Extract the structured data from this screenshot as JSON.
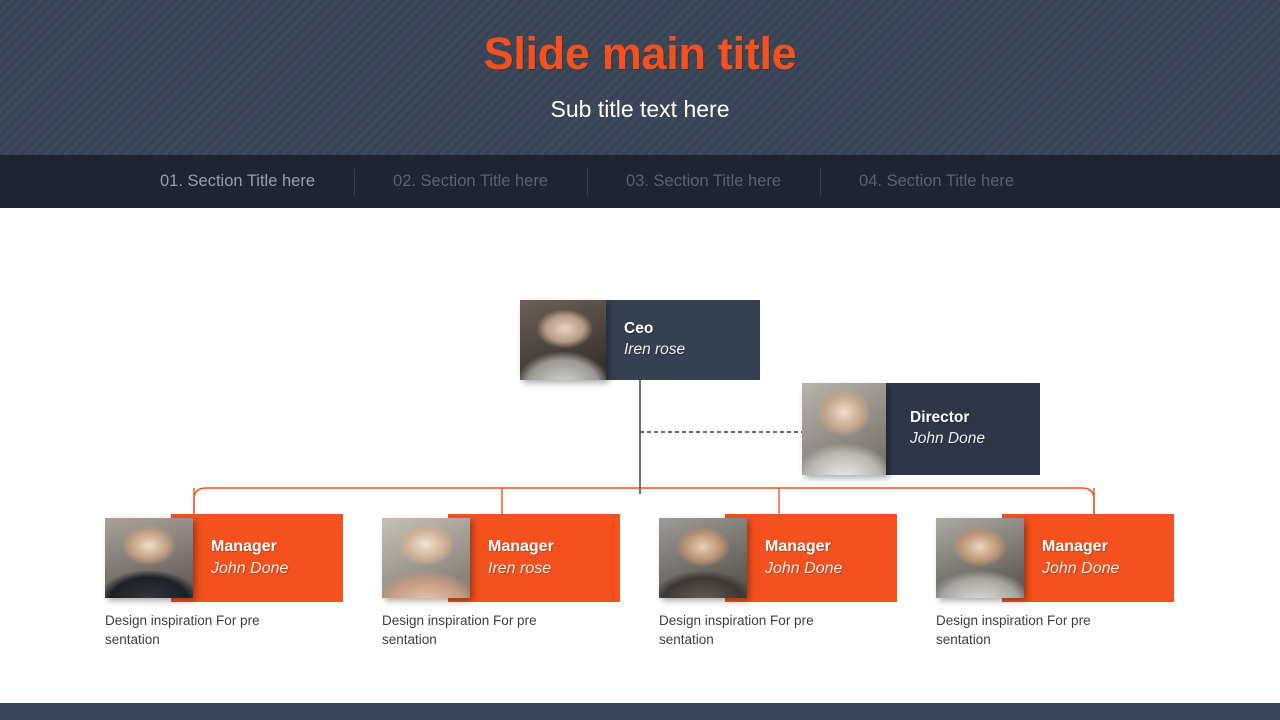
{
  "header": {
    "title": "Slide main title",
    "subtitle": "Sub title text here",
    "bg_color": "#3a4557",
    "title_color": "#f4511e",
    "subtitle_color": "#ffffff"
  },
  "nav": {
    "bg_color": "#1e2430",
    "active_color": "#93a0b2",
    "inactive_color": "#5a6374",
    "items": [
      {
        "label": "01. Section Title here",
        "active": true
      },
      {
        "label": "02. Section Title here",
        "active": false
      },
      {
        "label": "03. Section Title here",
        "active": false
      },
      {
        "label": "04. Section Title here",
        "active": false
      }
    ]
  },
  "org_chart": {
    "accent_color": "#f4511e",
    "node_dark_color": "#354050",
    "ceo": {
      "role": "Ceo",
      "name": "Iren rose",
      "photo": "portrait-woman-dark-hair"
    },
    "director": {
      "role": "Director",
      "name": "John Done",
      "photo": "portrait-man-bald-smiling"
    },
    "managers": [
      {
        "role": "Manager",
        "name": "John Done",
        "photo": "portrait-man-glasses-laughing",
        "caption": "Design inspiration For pre sentation"
      },
      {
        "role": "Manager",
        "name": "Iren rose",
        "photo": "portrait-woman-blonde-smiling",
        "caption": "Design inspiration For pre sentation"
      },
      {
        "role": "Manager",
        "name": "John Done",
        "photo": "portrait-man-beard-smiling",
        "caption": "Design inspiration For pre sentation"
      },
      {
        "role": "Manager",
        "name": "John Done",
        "photo": "portrait-man-dark-hair",
        "caption": "Design inspiration For pre sentation"
      }
    ]
  },
  "footer": {
    "bg_color": "#3a4557"
  }
}
